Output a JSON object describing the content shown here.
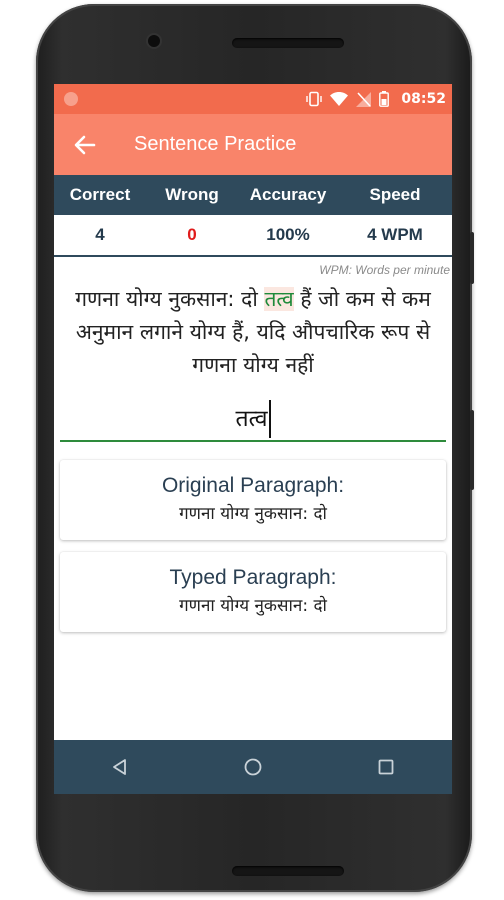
{
  "status_bar": {
    "time": "08:52",
    "icons": [
      "notification-dot-icon",
      "vibrate-icon",
      "wifi-icon",
      "no-signal-icon",
      "battery-icon"
    ]
  },
  "app_bar": {
    "title": "Sentence Practice",
    "back_icon": "back-arrow-icon"
  },
  "stats": {
    "headers": {
      "correct": "Correct",
      "wrong": "Wrong",
      "accuracy": "Accuracy",
      "speed": "Speed"
    },
    "values": {
      "correct": "4",
      "wrong": "0",
      "accuracy": "100%",
      "speed": "4 WPM"
    }
  },
  "wpm_note": "WPM: Words per minute",
  "practice": {
    "sentence_before": "गणना योग्य नुकसान: दो ",
    "sentence_highlight": "तत्व",
    "sentence_after": " हैं जो कम से कम अनुमान लगाने योग्य हैं, यदि औपचारिक रूप से गणना योग्य नहीं",
    "typed_value": "तत्व"
  },
  "original_card": {
    "title": "Original Paragraph:",
    "text": "गणना योग्य नुकसान: दो"
  },
  "typed_card": {
    "title": "Typed Paragraph:",
    "text": "गणना योग्य नुकसान: दो"
  },
  "colors": {
    "status_bar": "#f26b4d",
    "app_bar": "#f9846a",
    "stats_header": "#2f4a5c",
    "wrong_value": "#e01b1b",
    "highlight_text": "#1f8a3a",
    "input_underline": "#2e8b3c"
  },
  "nav_bar": {
    "icons": [
      "nav-back-icon",
      "nav-home-icon",
      "nav-recents-icon"
    ]
  }
}
